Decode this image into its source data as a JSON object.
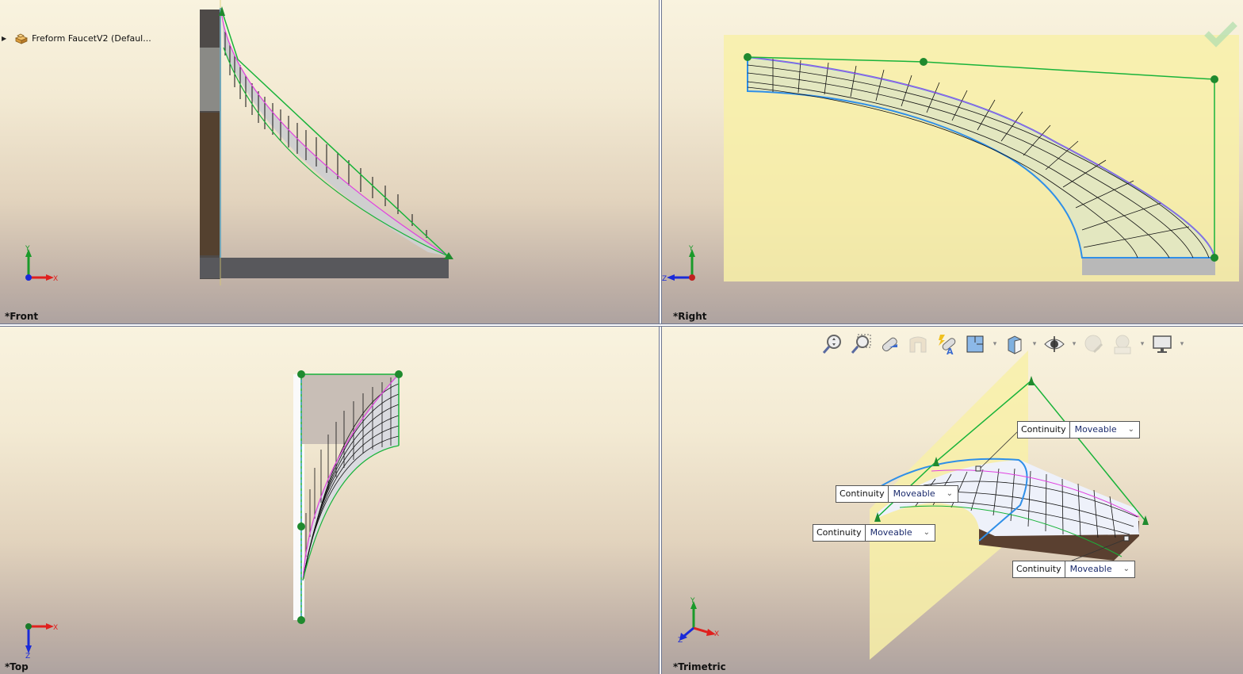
{
  "feature_tree": {
    "expand_icon": "triangle-right-icon",
    "part_icon": "part-icon",
    "part_name": "Freform FaucetV2  (Defaul..."
  },
  "viewports": [
    {
      "id": "front",
      "label": "*Front",
      "triad": [
        "Y",
        "X"
      ]
    },
    {
      "id": "right",
      "label": "*Right",
      "triad": [
        "Y",
        "Z"
      ]
    },
    {
      "id": "top",
      "label": "*Top",
      "triad": [
        "X",
        "Z"
      ]
    },
    {
      "id": "trimetric",
      "label": "*Trimetric",
      "triad": [
        "Y",
        "X",
        "Z"
      ]
    }
  ],
  "heads_up_toolbar": [
    {
      "name": "zoom-to-fit-icon",
      "dropdown": false
    },
    {
      "name": "zoom-to-area-icon",
      "dropdown": false
    },
    {
      "name": "previous-view-icon",
      "dropdown": false
    },
    {
      "name": "section-view-icon",
      "dropdown": false,
      "disabled": true
    },
    {
      "name": "dynamic-annotation-views-icon",
      "dropdown": false
    },
    {
      "name": "view-orientation-icon",
      "dropdown": true
    },
    {
      "name": "display-style-icon",
      "dropdown": true
    },
    {
      "name": "hide-show-items-icon",
      "dropdown": true
    },
    {
      "name": "edit-appearance-icon",
      "dropdown": false,
      "disabled": true
    },
    {
      "name": "apply-scene-icon",
      "dropdown": true,
      "disabled": true
    },
    {
      "name": "view-settings-icon",
      "dropdown": true
    }
  ],
  "confirm_icon": "checkmark-icon",
  "callouts": [
    {
      "label": "Continuity",
      "value": "Moveable"
    },
    {
      "label": "Continuity",
      "value": "Moveable"
    },
    {
      "label": "Continuity",
      "value": "Moveable"
    },
    {
      "label": "Continuity",
      "value": "Moveable"
    }
  ],
  "colors": {
    "control_polygon": "#19b33a",
    "boundary_edge": "#2f8fe8",
    "curvature_edge": "#e040e0",
    "control_point": "#1f8a2e",
    "plane_fill": "#f8f0a8",
    "axis_x": "#e0201e",
    "axis_y": "#1a9a2a",
    "axis_z": "#1a2ad8"
  }
}
